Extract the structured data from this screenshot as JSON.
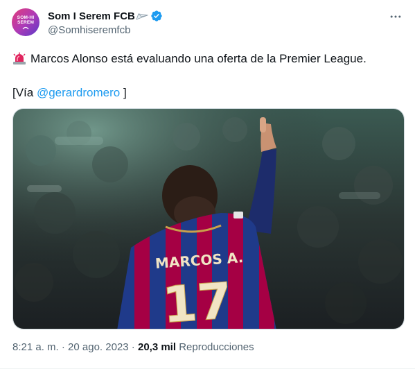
{
  "author": {
    "display_name": "Som I Serem FCB",
    "handle": "@Somhiseremfcb",
    "avatar_text_line1": "SOM-HI",
    "avatar_text_line2": "SEREM"
  },
  "tweet": {
    "text_line1": "Marcos Alonso está evaluando una oferta de la Premier League.",
    "via_open": "[Vía ",
    "via_mention": "@gerardromero",
    "via_close": " ]"
  },
  "media": {
    "jersey_name": "MARCOS A.",
    "jersey_number": "17"
  },
  "meta": {
    "time": "8:21 a. m.",
    "separator": " · ",
    "date": "20 ago. 2023",
    "views_count": "20,3 mil",
    "views_label": " Reproducciones"
  },
  "icons": {
    "verified": "verified-badge-icon",
    "more": "more-options-icon",
    "siren": "rotating-light-emoji-icon",
    "name_emoji": "paper-plane-emoji-icon"
  },
  "colors": {
    "accent": "#1d9bf0",
    "text_primary": "#0f1419",
    "text_secondary": "#536471",
    "barca_blue": "#1f3a8a",
    "barca_red": "#a50044"
  }
}
